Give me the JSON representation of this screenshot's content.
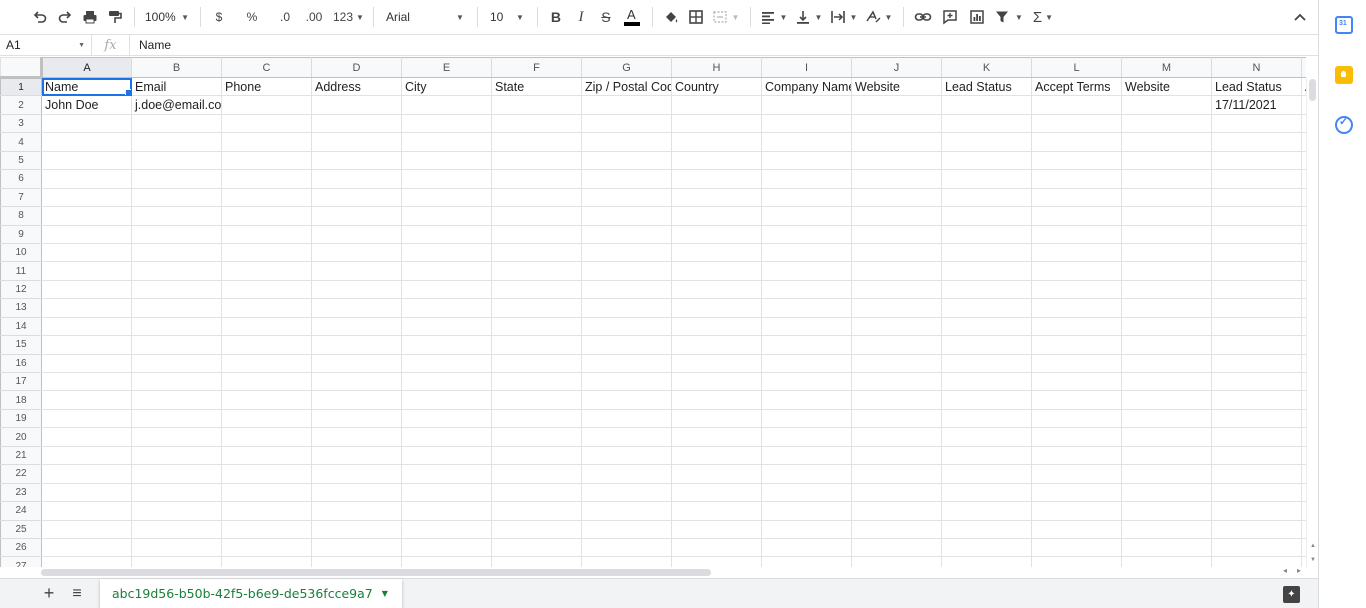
{
  "toolbar": {
    "zoom": "100%",
    "currency": "$",
    "percent": "%",
    "decrease_decimal": ".0",
    "increase_decimal": ".00",
    "number_format": "123",
    "font": "Arial",
    "font_size": "10"
  },
  "formula_bar": {
    "cell_ref": "A1",
    "fx": "fx",
    "content": "Name"
  },
  "grid": {
    "columns": [
      "A",
      "B",
      "C",
      "D",
      "E",
      "F",
      "G",
      "H",
      "I",
      "J",
      "K",
      "L",
      "M",
      "N"
    ],
    "row_count": 27,
    "selected": "A1",
    "row1": [
      "Name",
      "Email",
      "Phone",
      "Address",
      "City",
      "State",
      "Zip / Postal Code",
      "Country",
      "Company Name",
      "Website",
      "Lead Status",
      "Accept Terms",
      "Website",
      "Lead Status"
    ],
    "row1_overflow": "A",
    "row2": [
      "John Doe",
      "j.doe@email.com",
      "",
      "",
      "",
      "",
      "",
      "",
      "",
      "",
      "",
      "",
      "",
      "17/11/2021"
    ]
  },
  "sheet_tabs": {
    "add_label": "+",
    "list_label": "≡",
    "active_sheet": "abc19d56-b50b-42f5-b6e9-de536fcce9a7"
  },
  "colors": {
    "accent": "#1a73e8",
    "sheet_tab_text": "#188038"
  }
}
